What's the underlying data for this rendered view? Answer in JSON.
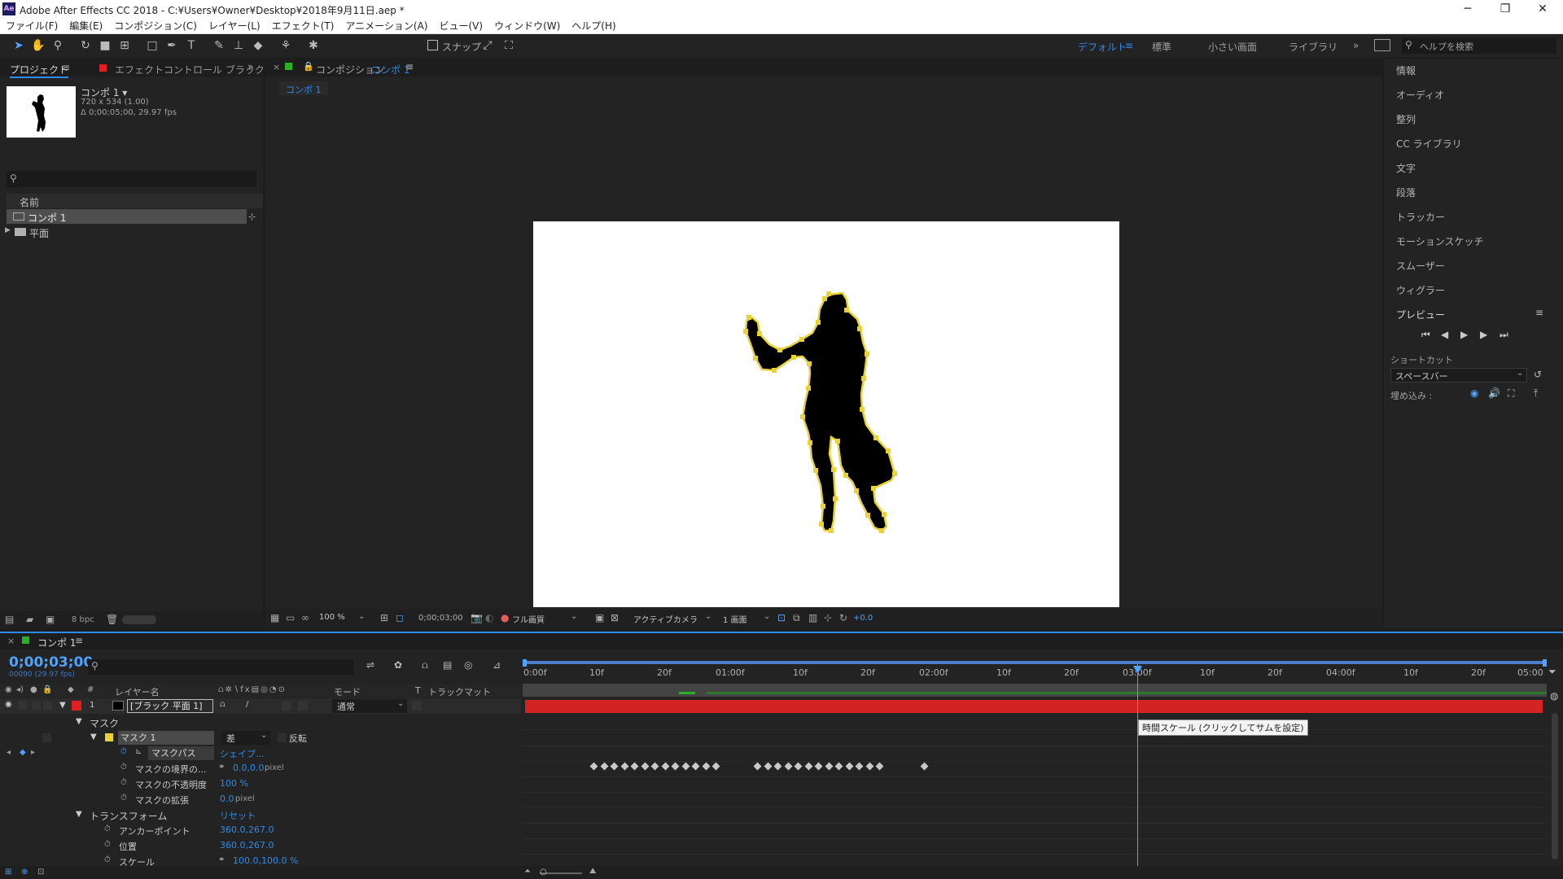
{
  "window": {
    "logo": "Ae",
    "title": "Adobe After Effects CC 2018 - C:¥Users¥Owner¥Desktop¥2018年9月11日.aep *",
    "minimize": "─",
    "maximize": "❐",
    "close": "✕"
  },
  "menu": [
    "ファイル(F)",
    "編集(E)",
    "コンポジション(C)",
    "レイヤー(L)",
    "エフェクト(T)",
    "アニメーション(A)",
    "ビュー(V)",
    "ウィンドウ(W)",
    "ヘルプ(H)"
  ],
  "toolbar": {
    "snap_label": "スナップ",
    "workspaces": [
      "デフォルト",
      "標準",
      "小さい画面",
      "ライブラリ"
    ],
    "active_workspace": "デフォルト",
    "more": "»",
    "search_placeholder": "ヘルプを検索"
  },
  "project": {
    "tab_project": "プロジェクト",
    "tab_effects": "エフェクトコントロール ブラック :",
    "expand": "»",
    "comp_name": "コンポ 1 ▾",
    "comp_size": "720 x 534 (1.00)",
    "comp_duration": "Δ 0;00;05;00, 29.97 fps",
    "col_name": "名前",
    "items": [
      "コンポ 1",
      "平面"
    ],
    "bpc": "8 bpc"
  },
  "composition": {
    "tab_label": "コンポジション",
    "tab_comp": "コンポ 1",
    "sub_tab": "コンポ 1",
    "zoom": "100 %",
    "timecode": "0;00;03;00",
    "resolution": "フル画質",
    "camera": "アクティブカメラ",
    "views": "1 画面",
    "exposure": "+0.0"
  },
  "right_panel": {
    "items": [
      "情報",
      "オーディオ",
      "整列",
      "CC ライブラリ",
      "文字",
      "段落",
      "トラッカー",
      "モーションスケッチ",
      "スムーザー",
      "ウィグラー",
      "プレビュー"
    ],
    "shortcut_label": "ショートカット",
    "shortcut_value": "スペースバー",
    "embed_label": "埋め込み :"
  },
  "timeline": {
    "tab": "コンポ 1",
    "timecode": "0;00;03;00",
    "timecode_sub": "00090 (29.97 fps)",
    "headers": {
      "num": "#",
      "layer_name": "レイヤー名",
      "mode": "モード",
      "t": "T",
      "trackmatte": "トラックマット"
    },
    "layer": {
      "num": "1",
      "name": "[ブラック 平面 1]",
      "mode": "通常"
    },
    "mask_group": "マスク",
    "mask1": "マスク 1",
    "mask_mode": "差",
    "invert": "反転",
    "mask_path": "マスクパス",
    "mask_path_value": "シェイプ...",
    "feather_label": "マスクの境界の...",
    "feather_value": "0.0,0.0",
    "feather_unit": "pixel",
    "opacity_label": "マスクの不透明度",
    "opacity_value": "100 %",
    "expansion_label": "マスクの拡張",
    "expansion_value": "0.0",
    "expansion_unit": "pixel",
    "transform": "トランスフォーム",
    "reset": "リセット",
    "anchor_label": "アンカーポイント",
    "anchor_value": "360.0,267.0",
    "position_label": "位置",
    "position_value": "360.0,267.0",
    "scale_label": "スケール",
    "scale_value": "100.0,100.0 %",
    "ruler": [
      "0:00f",
      "10f",
      "20f",
      "01:00f",
      "10f",
      "20f",
      "02:00f",
      "10f",
      "20f",
      "03:00f",
      "10f",
      "20f",
      "04:00f",
      "10f",
      "20f",
      "05:00"
    ],
    "tooltip": "時間スケール (クリックしてサムを設定)",
    "keyframe_groups": [
      13,
      13,
      1
    ],
    "current_time_fraction": 0.6
  },
  "colors": {
    "accent": "#2d8ceb",
    "layer_bar": "#d42323",
    "mask_outline": "#e8d235",
    "label_red": "#e02020",
    "label_green": "#28b028"
  }
}
